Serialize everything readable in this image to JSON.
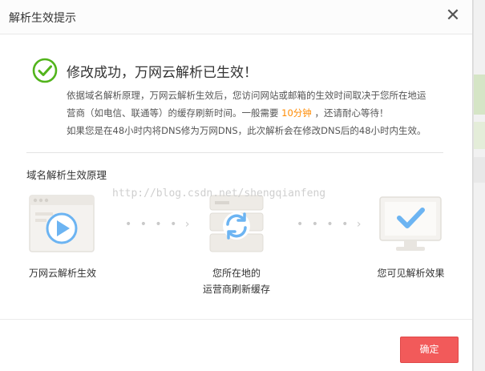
{
  "dialog": {
    "title": "解析生效提示",
    "close_label": "✕"
  },
  "success": {
    "title": "修改成功，万网云解析已生效！",
    "desc_line1": "依据域名解析原理，万网云解析生效后，您访问网站或邮箱的生效时间取决于您所在地运",
    "desc_line2_prefix": "营商（如电信、联通等）的缓存刷新时间。一般需要",
    "desc_line2_highlight": "10分钟",
    "desc_line2_suffix": "，还请耐心等待！",
    "desc_line3": "如果您是在48小时内将DNS修为万网DNS，此次解析会在修改DNS后的48小时内生效。"
  },
  "principle": {
    "title": "域名解析生效原理",
    "watermark": "http://blog.csdn.net/shengqianfeng",
    "steps": [
      {
        "line1": "万网云解析生效",
        "line2": "",
        "icon": "play-browser-icon"
      },
      {
        "line1": "您所在地的",
        "line2": "运营商刷新缓存",
        "icon": "refresh-server-icon"
      },
      {
        "line1": "您可见解析效果",
        "line2": "",
        "icon": "check-monitor-icon"
      }
    ],
    "arrow_glyph": "• • • • ›"
  },
  "footer": {
    "confirm_label": "确定"
  },
  "colors": {
    "success_green": "#52b41c",
    "highlight_orange": "#ff8a00",
    "confirm_red": "#f25a5a",
    "icon_blue": "#6cb4f2"
  }
}
